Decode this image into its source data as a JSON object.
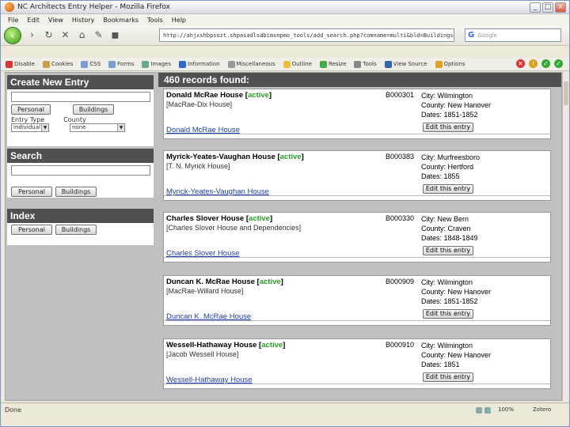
{
  "window": {
    "title": "NC Architects Entry Helper - Mozilla Firefox"
  },
  "menu": [
    "File",
    "Edit",
    "View",
    "History",
    "Bookmarks",
    "Tools",
    "Help"
  ],
  "nav": {
    "url": "http://ahjxshbpsuzt.shpasadlsdbimsnpmo_tools/add_search.php?comname=multi&bld=Buildings&show=e",
    "search_placeholder": "Google"
  },
  "toolbar2": [
    "Disable",
    "Cookies",
    "CSS",
    "Forms",
    "Images",
    "Information",
    "Miscellaneous",
    "Outline",
    "Resize",
    "Tools",
    "View Source",
    "Options"
  ],
  "sidebar": {
    "create": {
      "title": "Create New Entry",
      "btn_personal": "Personal",
      "btn_buildings": "Buildings",
      "entry_type_label": "Entry Type",
      "county_label": "County",
      "entry_type_value": "individual",
      "county_value": "none"
    },
    "search": {
      "title": "Search",
      "btn_personal": "Personal",
      "btn_buildings": "Buildings"
    },
    "index": {
      "title": "Index",
      "btn_personal": "Personal",
      "btn_buildings": "Buildings"
    }
  },
  "main": {
    "header": "460 records found:",
    "edit_label": "Edit this entry",
    "records": [
      {
        "name": "Donald McRae House",
        "status": "active",
        "alias": "[MacRae-Dix House]",
        "link": "Donald McRae House",
        "id": "B000301",
        "city": "City: Wilmington",
        "county": "County: New Hanover",
        "dates": "Dates: 1851-1852"
      },
      {
        "name": "Myrick-Yeates-Vaughan House",
        "status": "active",
        "alias": "[T. N. Myrick House]",
        "link": "Myrick-Yeates-Vaughan House",
        "id": "B000383",
        "city": "City: Murfreesboro",
        "county": "County: Hertford",
        "dates": "Dates: 1855"
      },
      {
        "name": "Charles Slover House",
        "status": "active",
        "alias": "[Charles Slover House and Dependencies]",
        "link": "Charles Slover House",
        "id": "B000330",
        "city": "City: New Bern",
        "county": "County: Craven",
        "dates": "Dates: 1848-1849"
      },
      {
        "name": "Duncan K. McRae House",
        "status": "active",
        "alias": "[MacRae-Willard House]",
        "link": "Duncan K. McRae House",
        "id": "B000909",
        "city": "City: Wilmington",
        "county": "County: New Hanover",
        "dates": "Dates: 1851-1852"
      },
      {
        "name": "Wessell-Hathaway House",
        "status": "active",
        "alias": "[Jacob Wessell House]",
        "link": "Wessell-Hathaway House",
        "id": "B000910",
        "city": "City: Wilmington",
        "county": "County: New Hanover",
        "dates": "Dates: 1851"
      }
    ]
  },
  "status": {
    "text": "Done",
    "zoom": "100%",
    "brand": "Zotero"
  }
}
